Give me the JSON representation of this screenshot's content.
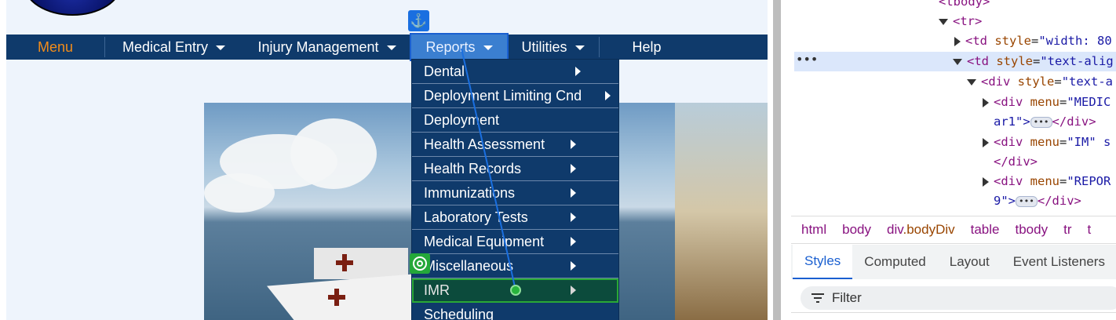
{
  "page": {
    "nav": {
      "menu": "Menu",
      "medical_entry": "Medical Entry",
      "injury_management": "Injury Management",
      "reports": "Reports",
      "utilities": "Utilities",
      "help": "Help"
    },
    "reports_menu": [
      {
        "label": "Dental",
        "has_submenu": true
      },
      {
        "label": "Deployment Limiting Cnd",
        "has_submenu": true
      },
      {
        "label": "Deployment",
        "has_submenu": false
      },
      {
        "label": "Health Assessment",
        "has_submenu": true
      },
      {
        "label": "Health Records",
        "has_submenu": true
      },
      {
        "label": "Immunizations",
        "has_submenu": true
      },
      {
        "label": "Laboratory Tests",
        "has_submenu": true
      },
      {
        "label": "Medical Equipment",
        "has_submenu": true
      },
      {
        "label": "Miscellaneous",
        "has_submenu": true
      },
      {
        "label": "IMR",
        "has_submenu": true,
        "highlighted": true
      },
      {
        "label": "Scheduling",
        "has_submenu": false
      }
    ],
    "overlay_icons": {
      "anchor": "anchor-icon",
      "target": "target-icon"
    },
    "colors": {
      "nav_bg": "#0f3a6b",
      "menu_label": "#f28c1a",
      "reports_active": "#3b7fd0",
      "highlight_green": "#2aa836",
      "anchor_blue": "#1a6fe0"
    }
  },
  "devtools": {
    "dom_lines": {
      "l0": "<tbody>",
      "l1": "<tr>",
      "l2_tag": "<td ",
      "l2_attr": "style",
      "l2_val": "\"width: 80",
      "l3_tag": "<td ",
      "l3_attr": "style",
      "l3_val": "\"text-alig",
      "l4_tag": "<div ",
      "l4_attr": "style",
      "l4_val": "\"text-a",
      "l5_tag": "<div ",
      "l5_attr": "menu",
      "l5_val": "\"MEDIC",
      "l6_val": "ar1\">",
      "l6_close": "</div>",
      "l7_tag": "<div ",
      "l7_attr": "menu",
      "l7_val": "\"IM\" s",
      "l8_close": "</div>",
      "l9_tag": "<div ",
      "l9_attr": "menu",
      "l9_val": "\"REPOR",
      "l10_val": "9\">",
      "l10_close": "</div>"
    },
    "ellipsis": "•••",
    "ellipsis_chip": "•••",
    "breadcrumb": [
      "html",
      "body",
      "div",
      ".bodyDiv",
      "table",
      "tbody",
      "tr",
      "t"
    ],
    "tabs": [
      "Styles",
      "Computed",
      "Layout",
      "Event Listeners"
    ],
    "active_tab": "Styles",
    "filter_placeholder": "Filter"
  }
}
